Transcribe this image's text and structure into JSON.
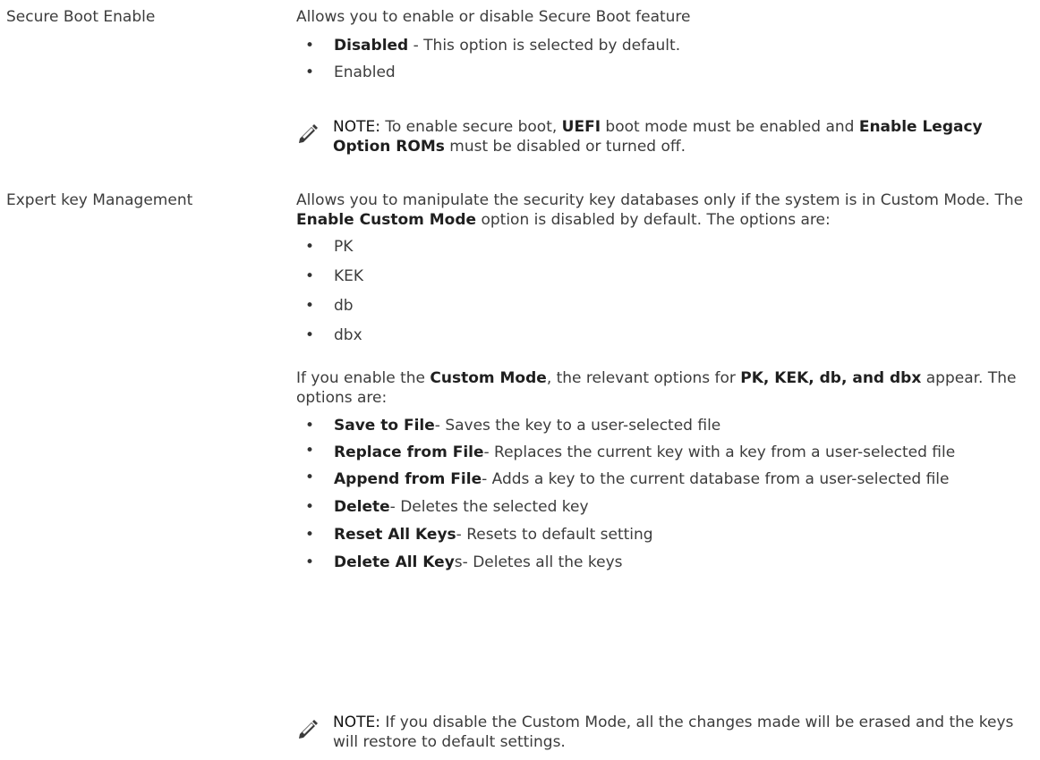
{
  "rows": [
    {
      "label": "Secure Boot Enable",
      "intro": "Allows you to enable or disable Secure Boot feature",
      "options": [
        {
          "bold": "Disabled",
          "rest": " - This option is selected by default."
        },
        {
          "bold": "",
          "rest": "Enabled"
        }
      ],
      "note": {
        "prefix": "NOTE:",
        "t1": " To enable secure boot, ",
        "b1": "UEFI",
        "t2": " boot mode must be enabled and ",
        "b2": "Enable Legacy Option ROMs",
        "t3": " must be disabled or turned off."
      }
    },
    {
      "label": "Expert key Management",
      "intro_t1": "Allows you to manipulate the security key databases only if the system is in Custom Mode. The ",
      "intro_b1": "Enable Custom Mode",
      "intro_t2": " option is disabled by default. The options are:",
      "keys": [
        "PK",
        "KEK",
        "db",
        "dbx"
      ],
      "custom_t1": "If you enable the ",
      "custom_b1": "Custom Mode",
      "custom_t2": ", the relevant options for ",
      "custom_b2": "PK, KEK, db, and dbx",
      "custom_t3": " appear. The options are:",
      "actions": [
        {
          "bold": "Save to File",
          "rest": "- Saves the key to a user-selected file"
        },
        {
          "bold": "Replace from File",
          "rest": "- Replaces the current key with a key from a user-selected file"
        },
        {
          "bold": "Append from File",
          "rest": "- Adds a key to the current database from a user-selected file"
        },
        {
          "bold": "Delete",
          "rest": "- Deletes the selected key"
        },
        {
          "bold": "Reset All Keys",
          "rest": "- Resets to default setting"
        },
        {
          "bold": "Delete All Key",
          "rest": "s- Deletes all the keys"
        }
      ],
      "note": {
        "prefix": "NOTE:",
        "text": " If you disable the Custom Mode, all the changes made will be erased and the keys will restore to default settings."
      }
    }
  ],
  "icons": {
    "note": "pencil-note-icon"
  }
}
